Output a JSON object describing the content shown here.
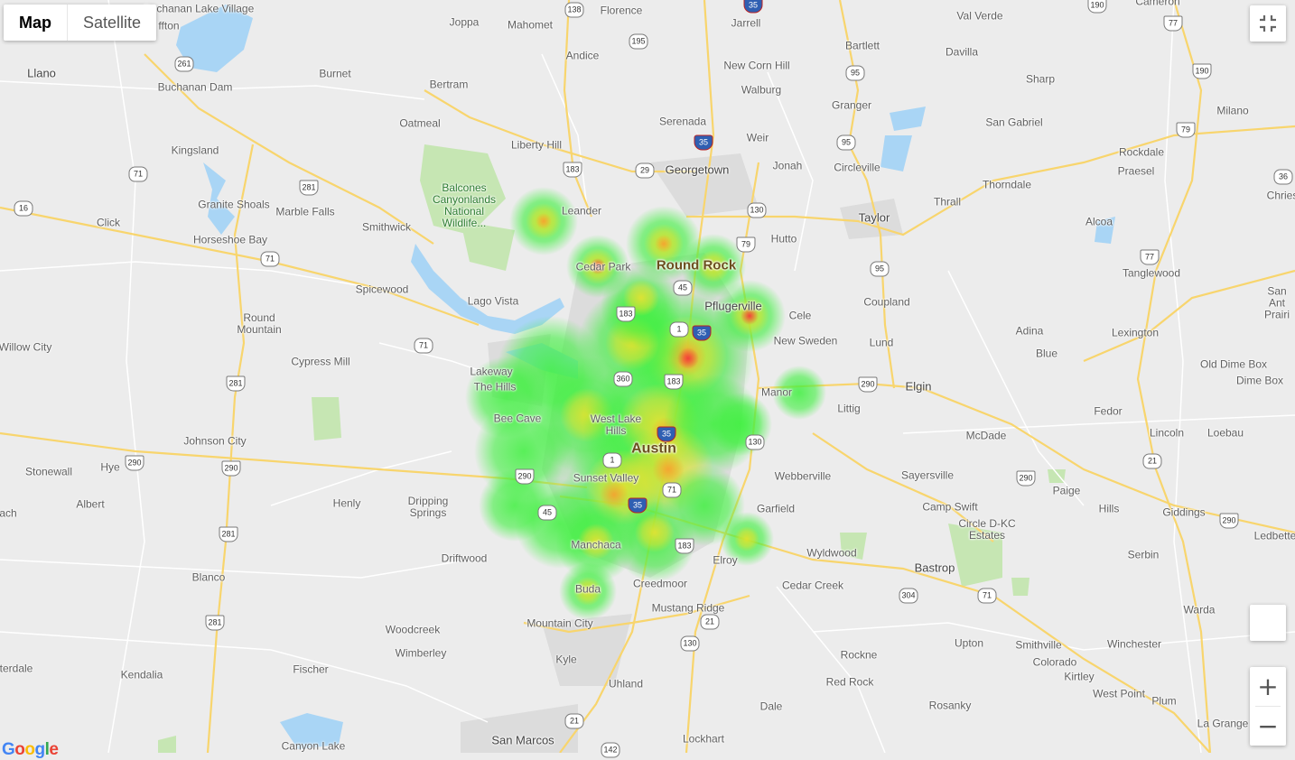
{
  "map_type": {
    "map_label": "Map",
    "satellite_label": "Satellite",
    "selected": "Map"
  },
  "controls": {
    "zoom_in": "+",
    "zoom_out": "−",
    "fullscreen_icon": "fullscreen-exit-icon"
  },
  "attribution": "Google",
  "heat_colors": {
    "low": "#3ff03f",
    "mid": "#f2e12e",
    "high": "#f23a3a"
  },
  "places": {
    "buchanan_lake_village": "Buchanan Lake Village",
    "joppa": "Joppa",
    "mahomet": "Mahomet",
    "florence": "Florence",
    "jarrell": "Jarrell",
    "val_verde": "Val Verde",
    "cameron": "Cameron",
    "bartlett": "Bartlett",
    "davilla": "Davilla",
    "llano": "Llano",
    "burnet": "Burnet",
    "bertram": "Bertram",
    "andice": "Andice",
    "new_corn_hill": "New Corn Hill",
    "walburg": "Walburg",
    "sharp": "Sharp",
    "buchanan_dam": "Buchanan Dam",
    "oatmeal": "Oatmeal",
    "serenada": "Serenada",
    "granger": "Granger",
    "san_gabriel": "San Gabriel",
    "milano": "Milano",
    "kingsland": "Kingsland",
    "liberty_hill": "Liberty Hill",
    "weir": "Weir",
    "rockdale": "Rockdale",
    "georgetown": "Georgetown",
    "jonah": "Jonah",
    "circleville": "Circleville",
    "praesel": "Praesel",
    "thorndale": "Thorndale",
    "balcones": "Balcones Canyonlands National Wildlife...",
    "granite_shoals": "Granite Shoals",
    "marble_falls": "Marble Falls",
    "leander": "Leander",
    "taylor": "Taylor",
    "thrall": "Thrall",
    "chriesman": "Chries",
    "click": "Click",
    "smithwick": "Smithwick",
    "horseshoe_bay": "Horseshoe Bay",
    "hutto": "Hutto",
    "alcoa": "Alcoa",
    "cedar_park": "Cedar Park",
    "round_rock": "Round Rock",
    "tanglewood": "Tanglewood",
    "spicewood": "Spicewood",
    "lago_vista": "Lago Vista",
    "pflugerville": "Pflugerville",
    "coupland": "Coupland",
    "san_antonio_prairie": "San Ant Prairi",
    "cele": "Cele",
    "round_mountain": "Round Mountain",
    "adina": "Adina",
    "lexington": "Lexington",
    "new_sweden": "New Sweden",
    "lund": "Lund",
    "willow_city": "Willow City",
    "blue": "Blue",
    "cypress_mill": "Cypress Mill",
    "lakeway": "Lakeway",
    "old_dime_box": "Old Dime Box",
    "the_hills": "The Hills",
    "dime_box": "Dime Box",
    "manor": "Manor",
    "elgin": "Elgin",
    "littig": "Littig",
    "fedor": "Fedor",
    "bee_cave": "Bee Cave",
    "west_lake_hills": "West Lake Hills",
    "mcdade": "McDade",
    "johnson_city": "Johnson City",
    "lincoln": "Lincoln",
    "loebau": "Loebau",
    "austin": "Austin",
    "stonewall": "Stonewall",
    "hye": "Hye",
    "webberville": "Webberville",
    "sayersville": "Sayersville",
    "paige": "Paige",
    "sunset_valley": "Sunset Valley",
    "albert": "Albert",
    "henly": "Henly",
    "dripping_springs": "Dripping Springs",
    "camp_swift": "Camp Swift",
    "garfield": "Garfield",
    "hills": "Hills",
    "giddings": "Giddings",
    "circle_dkc": "Circle D-KC Estates",
    "reach": "ach",
    "ledbetter": "Ledbette",
    "manchaca": "Manchaca",
    "serbin": "Serbin",
    "driftwood": "Driftwood",
    "wyldwood": "Wyldwood",
    "elroy": "Elroy",
    "bastrop": "Bastrop",
    "blanco": "Blanco",
    "creedmoor": "Creedmoor",
    "cedar_creek": "Cedar Creek",
    "buda": "Buda",
    "warda": "Warda",
    "mustang_ridge": "Mustang Ridge",
    "mountain_city": "Mountain City",
    "woodcreek": "Woodcreek",
    "upton": "Upton",
    "smithville": "Smithville",
    "winchester": "Winchester",
    "wimberley": "Wimberley",
    "kyle": "Kyle",
    "rockne": "Rockne",
    "colorado": "Colorado",
    "fischer": "Fischer",
    "kirtley": "Kirtley",
    "terdale": "terdale",
    "kendalia": "Kendalia",
    "uhland": "Uhland",
    "red_rock": "Red Rock",
    "west_point": "West Point",
    "plum": "Plum",
    "rosanky": "Rosanky",
    "dale": "Dale",
    "la_grange": "La Grange",
    "san_marcos": "San Marcos",
    "lockhart": "Lockhart",
    "canyon_lake": "Canyon Lake",
    "fluffton": "ffton"
  },
  "shields": {
    "s138": "138",
    "s195": "195",
    "s35a": "35",
    "s190a": "190",
    "s77a": "77",
    "s261": "261",
    "s95a": "95",
    "s190b": "190",
    "s79a": "79",
    "s35b": "35",
    "s95b": "95",
    "s71a": "71",
    "s183a": "183",
    "s29": "29",
    "s36": "36",
    "s281a": "281",
    "s130a": "130",
    "s16": "16",
    "s79b": "79",
    "s77b": "77",
    "s71b": "71",
    "s45a": "45",
    "s95c": "95",
    "s183b": "183",
    "s1a": "1",
    "s35c": "35",
    "s71c": "71",
    "s360": "360",
    "s183c": "183",
    "s290a": "290",
    "s281b": "281",
    "s35d": "35",
    "s130b": "130",
    "s290b": "290",
    "s290c": "290",
    "s1b": "1",
    "s290d": "290",
    "s21a": "21",
    "s290e": "290",
    "s71d": "71",
    "s45b": "45",
    "s35e": "35",
    "s290f": "290",
    "s281c": "281",
    "s183d": "183",
    "s304": "304",
    "s71e": "71",
    "s281d": "281",
    "s21b": "21",
    "s130c": "130",
    "s21c": "21",
    "s142": "142"
  }
}
